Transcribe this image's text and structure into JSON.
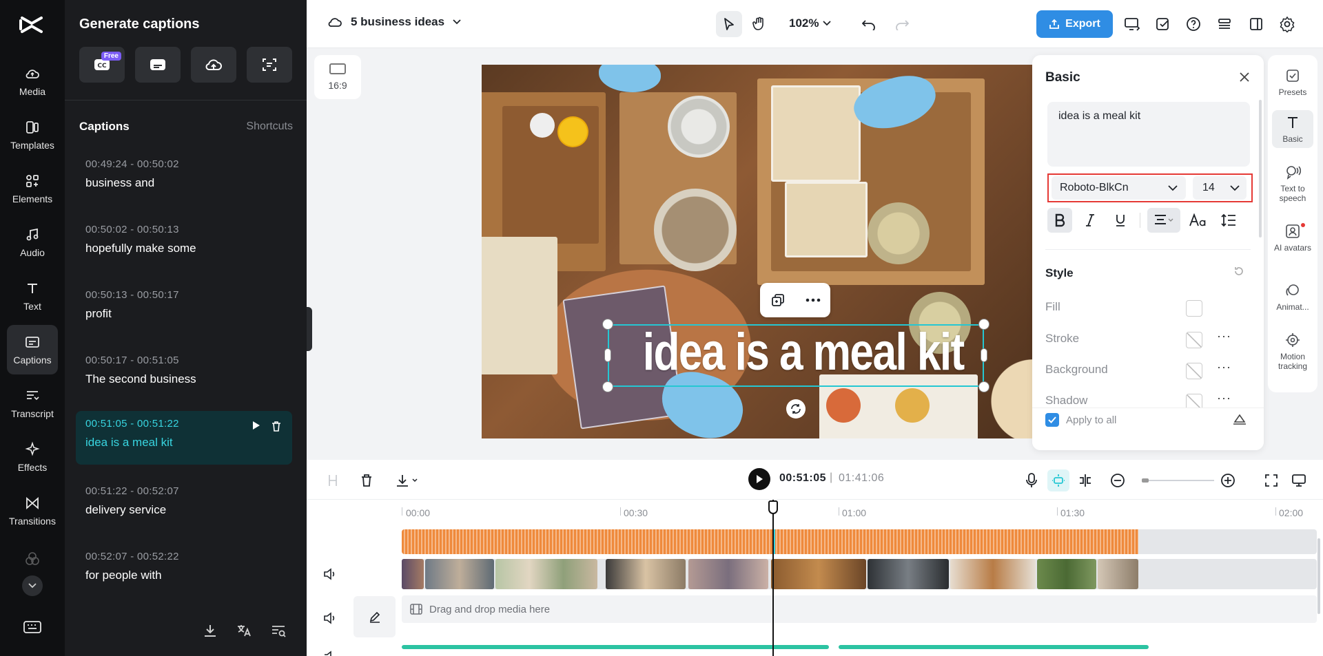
{
  "app": {
    "panel_title": "Generate captions",
    "free_badge": "Free"
  },
  "rail": {
    "items": [
      {
        "label": "Media",
        "icon": "cloud-icon"
      },
      {
        "label": "Templates",
        "icon": "templates-icon"
      },
      {
        "label": "Elements",
        "icon": "elements-icon"
      },
      {
        "label": "Audio",
        "icon": "music-note-icon"
      },
      {
        "label": "Text",
        "icon": "text-t-icon"
      },
      {
        "label": "Captions",
        "icon": "captions-icon"
      },
      {
        "label": "Transcript",
        "icon": "transcript-icon"
      },
      {
        "label": "Effects",
        "icon": "sparkle-icon"
      },
      {
        "label": "Transitions",
        "icon": "bowtie-icon"
      }
    ]
  },
  "captions": {
    "heading": "Captions",
    "shortcuts": "Shortcuts",
    "items": [
      {
        "time": "00:49:24 - 00:50:02",
        "text": "business and"
      },
      {
        "time": "00:50:02 - 00:50:13",
        "text": "hopefully make some"
      },
      {
        "time": "00:50:13 - 00:50:17",
        "text": "profit"
      },
      {
        "time": "00:50:17 - 00:51:05",
        "text": "The second business"
      },
      {
        "time": "00:51:05 - 00:51:22",
        "text": "idea is a meal kit"
      },
      {
        "time": "00:51:22 - 00:52:07",
        "text": "delivery service"
      },
      {
        "time": "00:52:07 - 00:52:22",
        "text": "for people with"
      }
    ],
    "active_index": 4
  },
  "topbar": {
    "project_name": "5 business ideas",
    "zoom": "102%",
    "export_label": "Export"
  },
  "canvas": {
    "aspect_ratio": "16:9",
    "overlay_text": "idea is a meal kit"
  },
  "basic": {
    "title": "Basic",
    "text_value": "idea is a meal kit",
    "font": "Roboto-BlkCn",
    "size": "14",
    "style_heading": "Style",
    "style_rows": [
      "Fill",
      "Stroke",
      "Background",
      "Shadow"
    ],
    "apply_to_all": "Apply to all",
    "apply_checked": true
  },
  "right_tools": [
    {
      "label": "Presets",
      "icon": "presets-icon"
    },
    {
      "label": "Basic",
      "icon": "text-t-icon"
    },
    {
      "label": "Text to speech",
      "icon": "speech-icon"
    },
    {
      "label": "AI avatars",
      "icon": "avatar-icon"
    },
    {
      "label": "Animat...",
      "icon": "animation-icon"
    },
    {
      "label": "Motion tracking",
      "icon": "target-icon"
    }
  ],
  "playback": {
    "current": "00:51:05",
    "separator": "|",
    "total": "01:41:06"
  },
  "timeline": {
    "ruler": [
      "00:00",
      "00:30",
      "01:00",
      "01:30",
      "02:00"
    ],
    "drop_placeholder": "Drag and drop media here"
  },
  "colors": {
    "accent": "#2f8de4",
    "caption_active": "#38d5e0",
    "selection": "#24c7d3",
    "audio_wave": "#ef8a3c",
    "highlight_border": "#e53935"
  }
}
